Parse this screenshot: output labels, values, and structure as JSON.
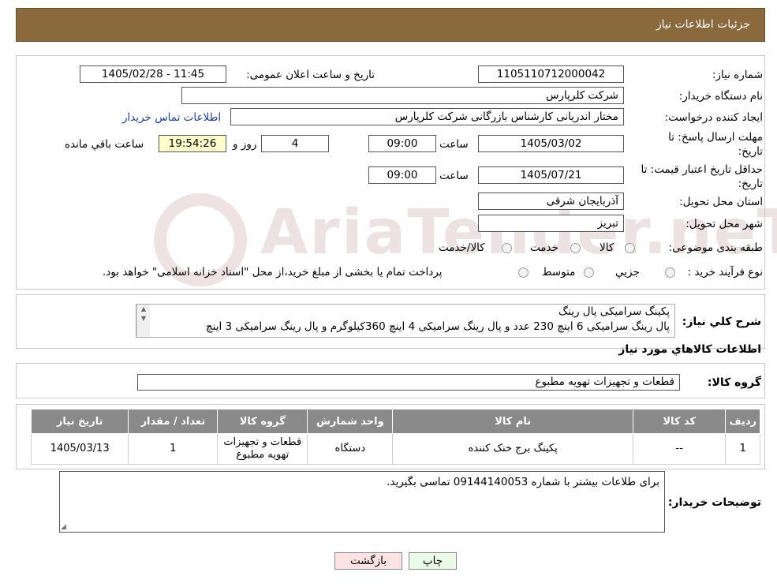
{
  "header": {
    "title": "جزئیات اطلاعات نیاز"
  },
  "form": {
    "need_number_label": "شماره نیاز:",
    "need_number": "1105110712000042",
    "announce_label": "تاریخ و ساعت اعلان عمومی:",
    "announce_value": "1405/02/28 - 11:45",
    "buyer_org_label": "نام دستگاه خریدار:",
    "buyer_org": "شرکت کلرپارس",
    "creator_label": "ایجاد کننده درخواست:",
    "creator": "مختار اندریانی کارشناس بازرگانی شرکت کلرپارس",
    "contact_link": "اطلاعات تماس خریدار",
    "deadline_label_1": "مهلت ارسال پاسخ: تا",
    "deadline_label_2": "تاریخ:",
    "deadline_date": "1405/03/02",
    "time_label": "ساعت",
    "deadline_time": "09:00",
    "days_value": "4",
    "days_label": "روز و",
    "remaining_time": "19:54:26",
    "remaining_label": "ساعت باقي مانده",
    "validity_label_1": "حداقل تاریخ اعتبار قیمت: تا",
    "validity_label_2": "تاریخ:",
    "validity_date": "1405/07/21",
    "validity_time": "09:00",
    "province_label": "استان محل تحویل:",
    "province": "آذربایجان شرقی",
    "city_label": "شهر محل تحویل:",
    "city": "تبریز",
    "category_label": "طبقه بندی موضوعی:",
    "category_options": [
      "کالا",
      "خدمت",
      "کالا/خدمت"
    ],
    "purchase_label": "نوع فرآیند خرید :",
    "purchase_options": [
      "جزیي",
      "متوسط"
    ],
    "purchase_note": "پرداخت تمام یا بخشی از مبلغ خرید،از محل \"اسناد خزانه اسلامی\" خواهد بود."
  },
  "watermark": {
    "text": "AriaTender.neT"
  },
  "summary": {
    "label": "شرح کلي نياز:",
    "line1": "پکینگ سرامیکی پال رینگ",
    "line2": "پال رینگ سرامیکی 6 اینچ 230 عدد و پال رینگ سرامیکی 4 اینچ 360کیلوگرم و پال رینگ سرامیکی 3 اینچ"
  },
  "goods_section": {
    "title": "اطلاعات کالاهاي مورد نياز",
    "group_label": "گروه کالا:",
    "group_value": "قطعات و تجهیزات تهویه مطبوع"
  },
  "table": {
    "headers": [
      "رديف",
      "کد کالا",
      "نام کالا",
      "واحد شمارش",
      "گروه کالا",
      "تعداد / مقدار",
      "تاريخ نياز"
    ],
    "rows": [
      [
        "1",
        "--",
        "پکینگ برج خنک کننده",
        "دستگاه",
        "قطعات و تجهیزات تهویه مطبوع",
        "1",
        "1405/03/13"
      ]
    ]
  },
  "notes": {
    "label": "توضیحات خریدار:",
    "text": "برای طلاعات بیشتر با شماره 09144140053 تماسی بگیرید."
  },
  "buttons": {
    "print": "چاپ",
    "back": "بازگشت"
  }
}
